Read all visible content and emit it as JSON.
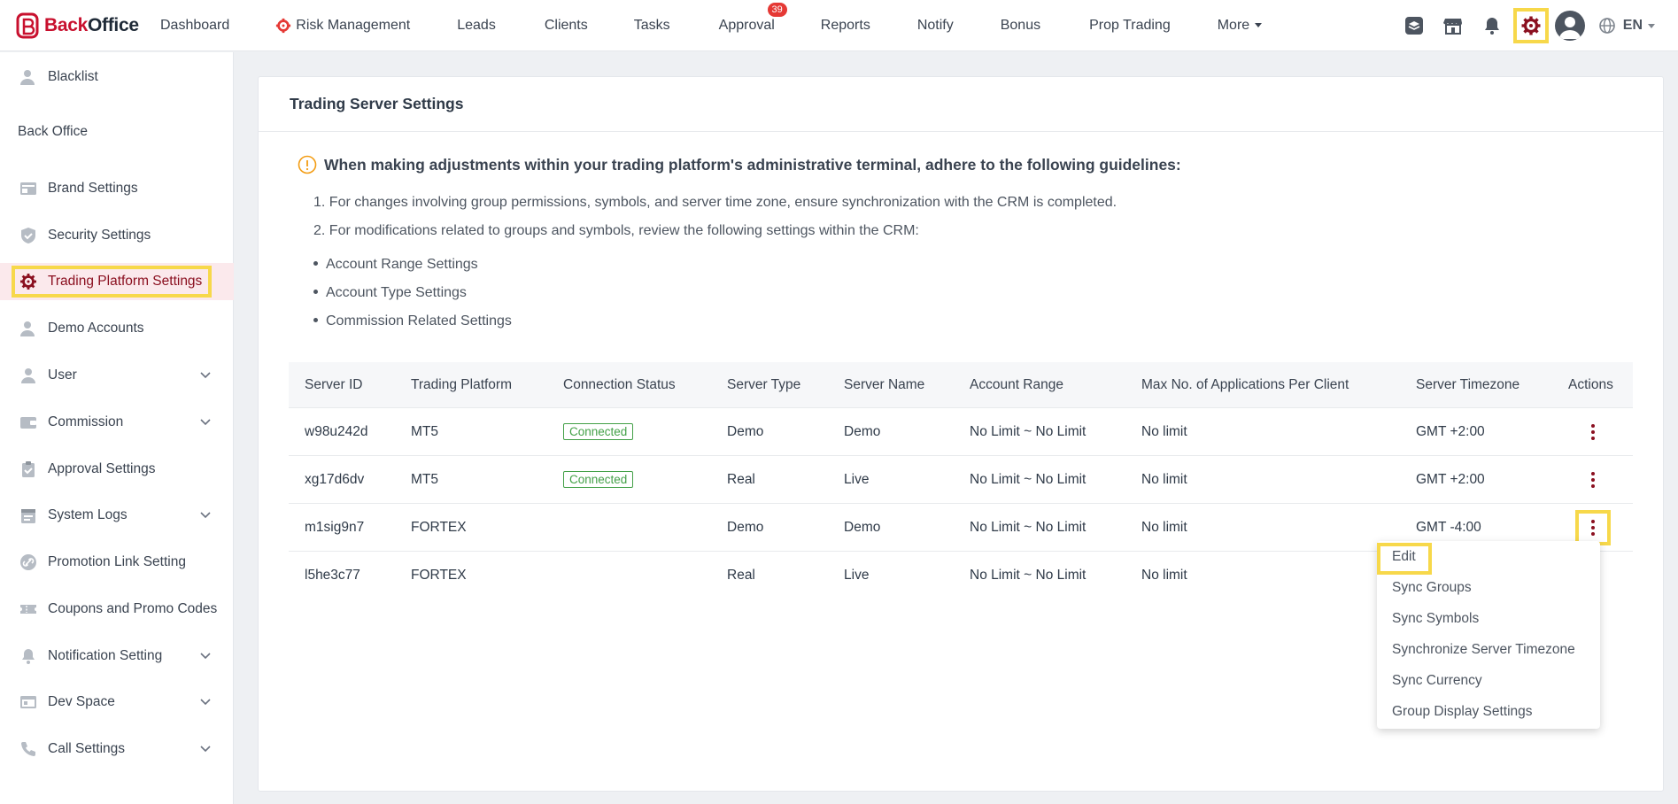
{
  "brand": {
    "name_part1": "Back",
    "name_part2": "Office"
  },
  "nav": {
    "items": [
      {
        "label": "Dashboard"
      },
      {
        "label": "Risk Management"
      },
      {
        "label": "Leads"
      },
      {
        "label": "Clients"
      },
      {
        "label": "Tasks"
      },
      {
        "label": "Approval",
        "badge": "39"
      },
      {
        "label": "Reports"
      },
      {
        "label": "Notify"
      },
      {
        "label": "Bonus"
      },
      {
        "label": "Prop Trading"
      },
      {
        "label": "More"
      }
    ],
    "language": "EN"
  },
  "sidebar": {
    "top_item": "Blacklist",
    "group_label": "Back Office",
    "items": [
      {
        "label": "Brand Settings"
      },
      {
        "label": "Security Settings"
      },
      {
        "label": "Trading Platform Settings"
      },
      {
        "label": "Demo Accounts"
      },
      {
        "label": "User"
      },
      {
        "label": "Commission"
      },
      {
        "label": "Approval Settings"
      },
      {
        "label": "System Logs"
      },
      {
        "label": "Promotion Link Setting"
      },
      {
        "label": "Coupons and Promo Codes"
      },
      {
        "label": "Notification Setting"
      },
      {
        "label": "Dev Space"
      },
      {
        "label": "Call Settings"
      }
    ]
  },
  "page": {
    "title": "Trading Server Settings",
    "notice_title": "When making adjustments within your trading platform's administrative terminal, adhere to the following guidelines:",
    "notice_lines": [
      "1. For changes involving group permissions, symbols, and server time zone, ensure synchronization with the CRM is completed.",
      "2. For modifications related to groups and symbols, review the following settings within the CRM:"
    ],
    "bullets": [
      "Account Range Settings",
      "Account Type Settings",
      "Commission Related Settings"
    ]
  },
  "table": {
    "headers": [
      "Server ID",
      "Trading Platform",
      "Connection Status",
      "Server Type",
      "Server Name",
      "Account Range",
      "Max No. of Applications Per Client",
      "Server Timezone",
      "Actions"
    ],
    "rows": [
      {
        "id": "w98u242d",
        "platform": "MT5",
        "status": "Connected",
        "type": "Demo",
        "name": "Demo",
        "range": "No Limit ~ No Limit",
        "max": "No limit",
        "tz": "GMT +2:00"
      },
      {
        "id": "xg17d6dv",
        "platform": "MT5",
        "status": "Connected",
        "type": "Real",
        "name": "Live",
        "range": "No Limit ~ No Limit",
        "max": "No limit",
        "tz": "GMT +2:00"
      },
      {
        "id": "m1sig9n7",
        "platform": "FORTEX",
        "status": "",
        "type": "Demo",
        "name": "Demo",
        "range": "No Limit ~ No Limit",
        "max": "No limit",
        "tz": "GMT -4:00"
      },
      {
        "id": "l5he3c77",
        "platform": "FORTEX",
        "status": "",
        "type": "Real",
        "name": "Live",
        "range": "No Limit ~ No Limit",
        "max": "No limit",
        "tz": ""
      }
    ]
  },
  "dropdown": {
    "items": [
      "Edit",
      "Sync Groups",
      "Sync Symbols",
      "Synchronize Server Timezone",
      "Sync Currency",
      "Group Display Settings"
    ]
  },
  "colors": {
    "brand": "#c8102e",
    "connected": "#43a047",
    "highlight": "#f7d84a",
    "kebab": "#8b1020"
  }
}
